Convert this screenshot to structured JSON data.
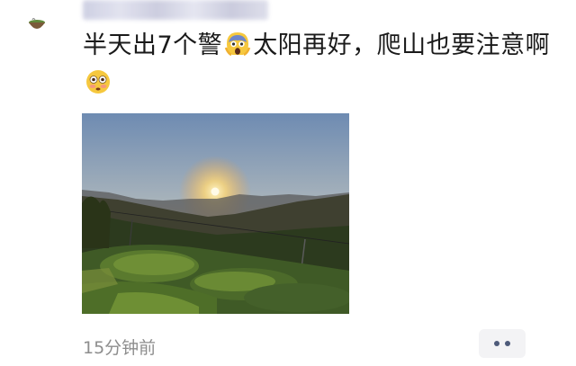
{
  "post": {
    "text_part1": "半天出7个警",
    "text_part2": "太阳再好，爬山也要注意啊",
    "emoji_1": "scream-face-icon",
    "emoji_2": "flushed-face-icon",
    "timestamp": "15分钟前",
    "image": "sunset-over-tea-hills"
  },
  "colors": {
    "text": "#1a1a1a",
    "timestamp": "#8d8d8d",
    "more_dots": "#4e5b7a",
    "more_bg": "#f3f3f5"
  }
}
